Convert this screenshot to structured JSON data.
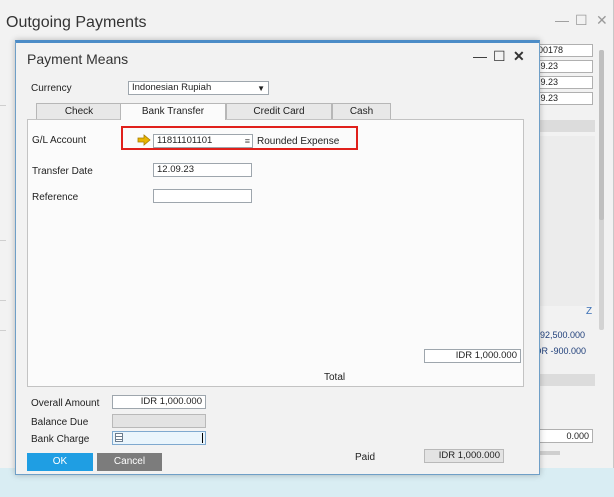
{
  "background_window": {
    "title": "Outgoing Payments",
    "fields": [
      "00178",
      ".9.23",
      ".9.23",
      ".9.23"
    ],
    "rows": [
      "192,500.000",
      "DR -900.000"
    ],
    "edge_link": "Z",
    "bottom_value": "0.000"
  },
  "dialog": {
    "title": "Payment Means",
    "currency_label": "Currency",
    "currency_value": "Indonesian Rupiah",
    "tabs": [
      "Check",
      "Bank Transfer",
      "Credit Card",
      "Cash"
    ],
    "active_tab": "Bank Transfer",
    "gl_account_label": "G/L Account",
    "gl_account_value": "11811101101",
    "gl_account_name": "Rounded Expense",
    "transfer_date_label": "Transfer Date",
    "transfer_date_value": "12.09.23",
    "reference_label": "Reference",
    "reference_value": "",
    "total_label": "Total",
    "total_value": "IDR 1,000.000",
    "overall_amount_label": "Overall Amount",
    "overall_amount_value": "IDR 1,000.000",
    "balance_due_label": "Balance Due",
    "balance_due_value": "",
    "bank_charge_label": "Bank Charge",
    "bank_charge_value": "",
    "paid_label": "Paid",
    "paid_value": "IDR 1,000.000",
    "ok_label": "OK",
    "cancel_label": "Cancel"
  },
  "colors": {
    "accent": "#1f9ee3",
    "highlight": "#e0201b",
    "arrow": "#e8b400",
    "title_bar": "#4c8cc7"
  }
}
